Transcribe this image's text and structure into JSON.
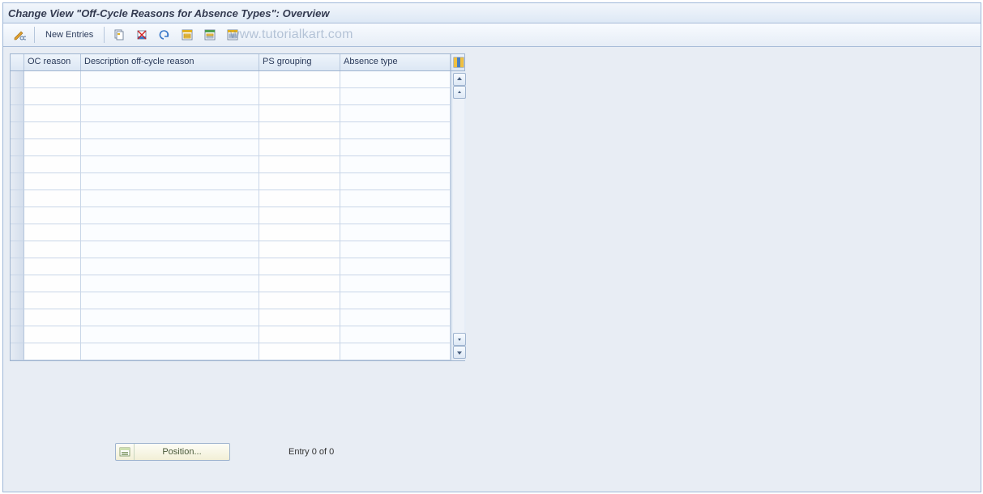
{
  "title_bar": {
    "title": "Change View \"Off-Cycle Reasons for Absence Types\": Overview"
  },
  "toolbar": {
    "toggle_icon": "pencil-glasses-icon",
    "new_entries_label": "New Entries",
    "copy_icon": "copy-icon",
    "delete_icon": "delete-icon",
    "undo_icon": "undo-icon",
    "select_all_icon": "select-all-icon",
    "select_block_icon": "select-block-icon",
    "deselect_all_icon": "deselect-all-icon"
  },
  "watermark": "www.tutorialkart.com",
  "grid": {
    "columns": [
      {
        "key": "oc_reason",
        "label": "OC reason"
      },
      {
        "key": "desc",
        "label": "Description off-cycle reason"
      },
      {
        "key": "ps_group",
        "label": "PS grouping"
      },
      {
        "key": "abs_type",
        "label": "Absence type"
      }
    ],
    "config_icon": "table-settings-icon",
    "rows": [
      {
        "oc_reason": "",
        "desc": "",
        "ps_group": "",
        "abs_type": ""
      },
      {
        "oc_reason": "",
        "desc": "",
        "ps_group": "",
        "abs_type": ""
      },
      {
        "oc_reason": "",
        "desc": "",
        "ps_group": "",
        "abs_type": ""
      },
      {
        "oc_reason": "",
        "desc": "",
        "ps_group": "",
        "abs_type": ""
      },
      {
        "oc_reason": "",
        "desc": "",
        "ps_group": "",
        "abs_type": ""
      },
      {
        "oc_reason": "",
        "desc": "",
        "ps_group": "",
        "abs_type": ""
      },
      {
        "oc_reason": "",
        "desc": "",
        "ps_group": "",
        "abs_type": ""
      },
      {
        "oc_reason": "",
        "desc": "",
        "ps_group": "",
        "abs_type": ""
      },
      {
        "oc_reason": "",
        "desc": "",
        "ps_group": "",
        "abs_type": ""
      },
      {
        "oc_reason": "",
        "desc": "",
        "ps_group": "",
        "abs_type": ""
      },
      {
        "oc_reason": "",
        "desc": "",
        "ps_group": "",
        "abs_type": ""
      },
      {
        "oc_reason": "",
        "desc": "",
        "ps_group": "",
        "abs_type": ""
      },
      {
        "oc_reason": "",
        "desc": "",
        "ps_group": "",
        "abs_type": ""
      },
      {
        "oc_reason": "",
        "desc": "",
        "ps_group": "",
        "abs_type": ""
      },
      {
        "oc_reason": "",
        "desc": "",
        "ps_group": "",
        "abs_type": ""
      },
      {
        "oc_reason": "",
        "desc": "",
        "ps_group": "",
        "abs_type": ""
      },
      {
        "oc_reason": "",
        "desc": "",
        "ps_group": "",
        "abs_type": ""
      }
    ]
  },
  "footer": {
    "position_label": "Position...",
    "entry_status": "Entry 0 of 0"
  }
}
